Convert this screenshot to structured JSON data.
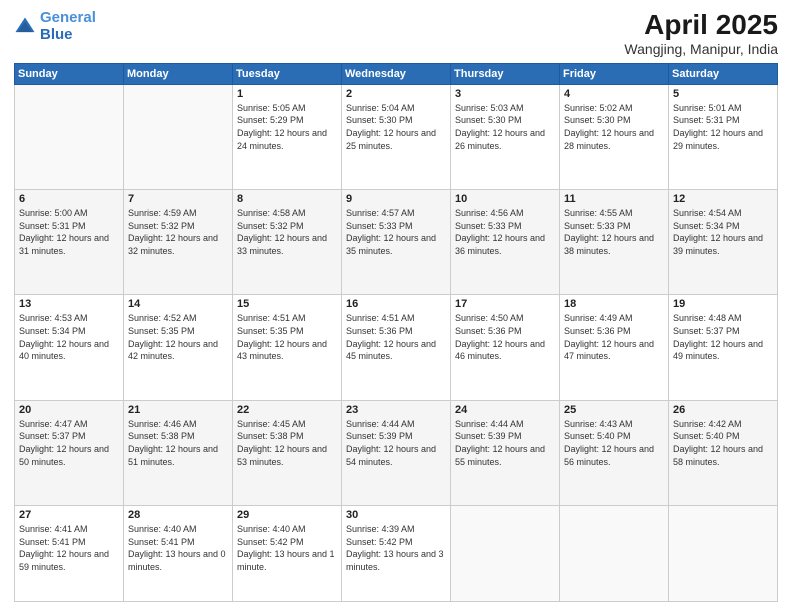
{
  "header": {
    "logo_line1": "General",
    "logo_line2": "Blue",
    "title": "April 2025",
    "subtitle": "Wangjing, Manipur, India"
  },
  "weekdays": [
    "Sunday",
    "Monday",
    "Tuesday",
    "Wednesday",
    "Thursday",
    "Friday",
    "Saturday"
  ],
  "weeks": [
    [
      {
        "num": "",
        "info": ""
      },
      {
        "num": "",
        "info": ""
      },
      {
        "num": "1",
        "info": "Sunrise: 5:05 AM\nSunset: 5:29 PM\nDaylight: 12 hours and 24 minutes."
      },
      {
        "num": "2",
        "info": "Sunrise: 5:04 AM\nSunset: 5:30 PM\nDaylight: 12 hours and 25 minutes."
      },
      {
        "num": "3",
        "info": "Sunrise: 5:03 AM\nSunset: 5:30 PM\nDaylight: 12 hours and 26 minutes."
      },
      {
        "num": "4",
        "info": "Sunrise: 5:02 AM\nSunset: 5:30 PM\nDaylight: 12 hours and 28 minutes."
      },
      {
        "num": "5",
        "info": "Sunrise: 5:01 AM\nSunset: 5:31 PM\nDaylight: 12 hours and 29 minutes."
      }
    ],
    [
      {
        "num": "6",
        "info": "Sunrise: 5:00 AM\nSunset: 5:31 PM\nDaylight: 12 hours and 31 minutes."
      },
      {
        "num": "7",
        "info": "Sunrise: 4:59 AM\nSunset: 5:32 PM\nDaylight: 12 hours and 32 minutes."
      },
      {
        "num": "8",
        "info": "Sunrise: 4:58 AM\nSunset: 5:32 PM\nDaylight: 12 hours and 33 minutes."
      },
      {
        "num": "9",
        "info": "Sunrise: 4:57 AM\nSunset: 5:33 PM\nDaylight: 12 hours and 35 minutes."
      },
      {
        "num": "10",
        "info": "Sunrise: 4:56 AM\nSunset: 5:33 PM\nDaylight: 12 hours and 36 minutes."
      },
      {
        "num": "11",
        "info": "Sunrise: 4:55 AM\nSunset: 5:33 PM\nDaylight: 12 hours and 38 minutes."
      },
      {
        "num": "12",
        "info": "Sunrise: 4:54 AM\nSunset: 5:34 PM\nDaylight: 12 hours and 39 minutes."
      }
    ],
    [
      {
        "num": "13",
        "info": "Sunrise: 4:53 AM\nSunset: 5:34 PM\nDaylight: 12 hours and 40 minutes."
      },
      {
        "num": "14",
        "info": "Sunrise: 4:52 AM\nSunset: 5:35 PM\nDaylight: 12 hours and 42 minutes."
      },
      {
        "num": "15",
        "info": "Sunrise: 4:51 AM\nSunset: 5:35 PM\nDaylight: 12 hours and 43 minutes."
      },
      {
        "num": "16",
        "info": "Sunrise: 4:51 AM\nSunset: 5:36 PM\nDaylight: 12 hours and 45 minutes."
      },
      {
        "num": "17",
        "info": "Sunrise: 4:50 AM\nSunset: 5:36 PM\nDaylight: 12 hours and 46 minutes."
      },
      {
        "num": "18",
        "info": "Sunrise: 4:49 AM\nSunset: 5:36 PM\nDaylight: 12 hours and 47 minutes."
      },
      {
        "num": "19",
        "info": "Sunrise: 4:48 AM\nSunset: 5:37 PM\nDaylight: 12 hours and 49 minutes."
      }
    ],
    [
      {
        "num": "20",
        "info": "Sunrise: 4:47 AM\nSunset: 5:37 PM\nDaylight: 12 hours and 50 minutes."
      },
      {
        "num": "21",
        "info": "Sunrise: 4:46 AM\nSunset: 5:38 PM\nDaylight: 12 hours and 51 minutes."
      },
      {
        "num": "22",
        "info": "Sunrise: 4:45 AM\nSunset: 5:38 PM\nDaylight: 12 hours and 53 minutes."
      },
      {
        "num": "23",
        "info": "Sunrise: 4:44 AM\nSunset: 5:39 PM\nDaylight: 12 hours and 54 minutes."
      },
      {
        "num": "24",
        "info": "Sunrise: 4:44 AM\nSunset: 5:39 PM\nDaylight: 12 hours and 55 minutes."
      },
      {
        "num": "25",
        "info": "Sunrise: 4:43 AM\nSunset: 5:40 PM\nDaylight: 12 hours and 56 minutes."
      },
      {
        "num": "26",
        "info": "Sunrise: 4:42 AM\nSunset: 5:40 PM\nDaylight: 12 hours and 58 minutes."
      }
    ],
    [
      {
        "num": "27",
        "info": "Sunrise: 4:41 AM\nSunset: 5:41 PM\nDaylight: 12 hours and 59 minutes."
      },
      {
        "num": "28",
        "info": "Sunrise: 4:40 AM\nSunset: 5:41 PM\nDaylight: 13 hours and 0 minutes."
      },
      {
        "num": "29",
        "info": "Sunrise: 4:40 AM\nSunset: 5:42 PM\nDaylight: 13 hours and 1 minute."
      },
      {
        "num": "30",
        "info": "Sunrise: 4:39 AM\nSunset: 5:42 PM\nDaylight: 13 hours and 3 minutes."
      },
      {
        "num": "",
        "info": ""
      },
      {
        "num": "",
        "info": ""
      },
      {
        "num": "",
        "info": ""
      }
    ]
  ]
}
